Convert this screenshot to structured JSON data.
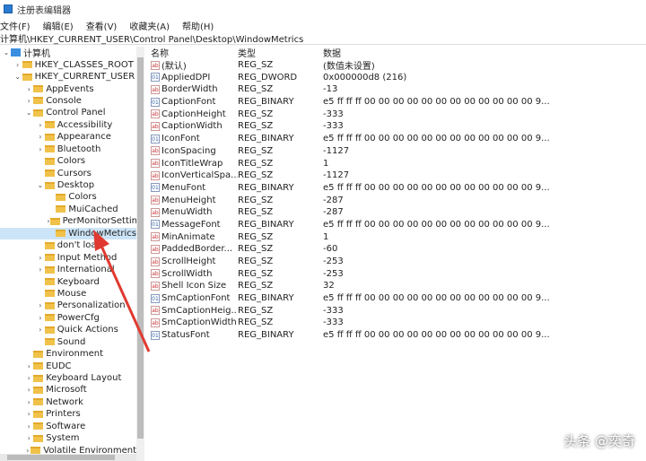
{
  "window": {
    "title": "注册表编辑器"
  },
  "menu": [
    "文件(F)",
    "编辑(E)",
    "查看(V)",
    "收藏夹(A)",
    "帮助(H)"
  ],
  "address": "计算机\\HKEY_CURRENT_USER\\Control Panel\\Desktop\\WindowMetrics",
  "tree": [
    {
      "label": "计算机",
      "level": 0,
      "chev": "v",
      "pc": true
    },
    {
      "label": "HKEY_CLASSES_ROOT",
      "level": 1,
      "chev": ">"
    },
    {
      "label": "HKEY_CURRENT_USER",
      "level": 1,
      "chev": "v"
    },
    {
      "label": "AppEvents",
      "level": 2,
      "chev": ">"
    },
    {
      "label": "Console",
      "level": 2,
      "chev": ">"
    },
    {
      "label": "Control Panel",
      "level": 2,
      "chev": "v"
    },
    {
      "label": "Accessibility",
      "level": 3,
      "chev": ">"
    },
    {
      "label": "Appearance",
      "level": 3,
      "chev": ">"
    },
    {
      "label": "Bluetooth",
      "level": 3,
      "chev": ">"
    },
    {
      "label": "Colors",
      "level": 3,
      "chev": ""
    },
    {
      "label": "Cursors",
      "level": 3,
      "chev": ""
    },
    {
      "label": "Desktop",
      "level": 3,
      "chev": "v"
    },
    {
      "label": "Colors",
      "level": 4,
      "chev": ""
    },
    {
      "label": "MuiCached",
      "level": 4,
      "chev": ""
    },
    {
      "label": "PerMonitorSettings",
      "level": 4,
      "chev": ">"
    },
    {
      "label": "WindowMetrics",
      "level": 4,
      "chev": "",
      "selected": true
    },
    {
      "label": "don't load",
      "level": 3,
      "chev": ""
    },
    {
      "label": "Input Method",
      "level": 3,
      "chev": ">"
    },
    {
      "label": "International",
      "level": 3,
      "chev": ">"
    },
    {
      "label": "Keyboard",
      "level": 3,
      "chev": ""
    },
    {
      "label": "Mouse",
      "level": 3,
      "chev": ""
    },
    {
      "label": "Personalization",
      "level": 3,
      "chev": ">"
    },
    {
      "label": "PowerCfg",
      "level": 3,
      "chev": ">"
    },
    {
      "label": "Quick Actions",
      "level": 3,
      "chev": ">"
    },
    {
      "label": "Sound",
      "level": 3,
      "chev": ""
    },
    {
      "label": "Environment",
      "level": 2,
      "chev": ""
    },
    {
      "label": "EUDC",
      "level": 2,
      "chev": ">"
    },
    {
      "label": "Keyboard Layout",
      "level": 2,
      "chev": ">"
    },
    {
      "label": "Microsoft",
      "level": 2,
      "chev": ">"
    },
    {
      "label": "Network",
      "level": 2,
      "chev": ">"
    },
    {
      "label": "Printers",
      "level": 2,
      "chev": ">"
    },
    {
      "label": "Software",
      "level": 2,
      "chev": ">"
    },
    {
      "label": "System",
      "level": 2,
      "chev": ">"
    },
    {
      "label": "Volatile Environment",
      "level": 2,
      "chev": ">"
    }
  ],
  "columns": {
    "name": "名称",
    "type": "类型",
    "data": "数据"
  },
  "values": [
    [
      "(默认)",
      "REG_SZ",
      "(数值未设置)"
    ],
    [
      "AppliedDPI",
      "REG_DWORD",
      "0x000000d8 (216)"
    ],
    [
      "BorderWidth",
      "REG_SZ",
      "-13"
    ],
    [
      "CaptionFont",
      "REG_BINARY",
      "e5 ff ff ff 00 00 00 00 00 00 00 00 00 00 00 00 9..."
    ],
    [
      "CaptionHeight",
      "REG_SZ",
      "-333"
    ],
    [
      "CaptionWidth",
      "REG_SZ",
      "-333"
    ],
    [
      "IconFont",
      "REG_BINARY",
      "e5 ff ff ff 00 00 00 00 00 00 00 00 00 00 00 00 9..."
    ],
    [
      "IconSpacing",
      "REG_SZ",
      "-1127"
    ],
    [
      "IconTitleWrap",
      "REG_SZ",
      "1"
    ],
    [
      "IconVerticalSpa...",
      "REG_SZ",
      "-1127"
    ],
    [
      "MenuFont",
      "REG_BINARY",
      "e5 ff ff ff 00 00 00 00 00 00 00 00 00 00 00 00 9..."
    ],
    [
      "MenuHeight",
      "REG_SZ",
      "-287"
    ],
    [
      "MenuWidth",
      "REG_SZ",
      "-287"
    ],
    [
      "MessageFont",
      "REG_BINARY",
      "e5 ff ff ff 00 00 00 00 00 00 00 00 00 00 00 00 9..."
    ],
    [
      "MinAnimate",
      "REG_SZ",
      "1"
    ],
    [
      "PaddedBorder...",
      "REG_SZ",
      "-60"
    ],
    [
      "ScrollHeight",
      "REG_SZ",
      "-253"
    ],
    [
      "ScrollWidth",
      "REG_SZ",
      "-253"
    ],
    [
      "Shell Icon Size",
      "REG_SZ",
      "32"
    ],
    [
      "SmCaptionFont",
      "REG_BINARY",
      "e5 ff ff ff 00 00 00 00 00 00 00 00 00 00 00 00 9..."
    ],
    [
      "SmCaptionHeig...",
      "REG_SZ",
      "-333"
    ],
    [
      "SmCaptionWidth",
      "REG_SZ",
      "-333"
    ],
    [
      "StatusFont",
      "REG_BINARY",
      "e5 ff ff ff 00 00 00 00 00 00 00 00 00 00 00 00 9..."
    ]
  ],
  "watermark": "头条 @奕奇",
  "colors": {
    "selection": "#cce4f7",
    "arrow": "#e03a30"
  }
}
